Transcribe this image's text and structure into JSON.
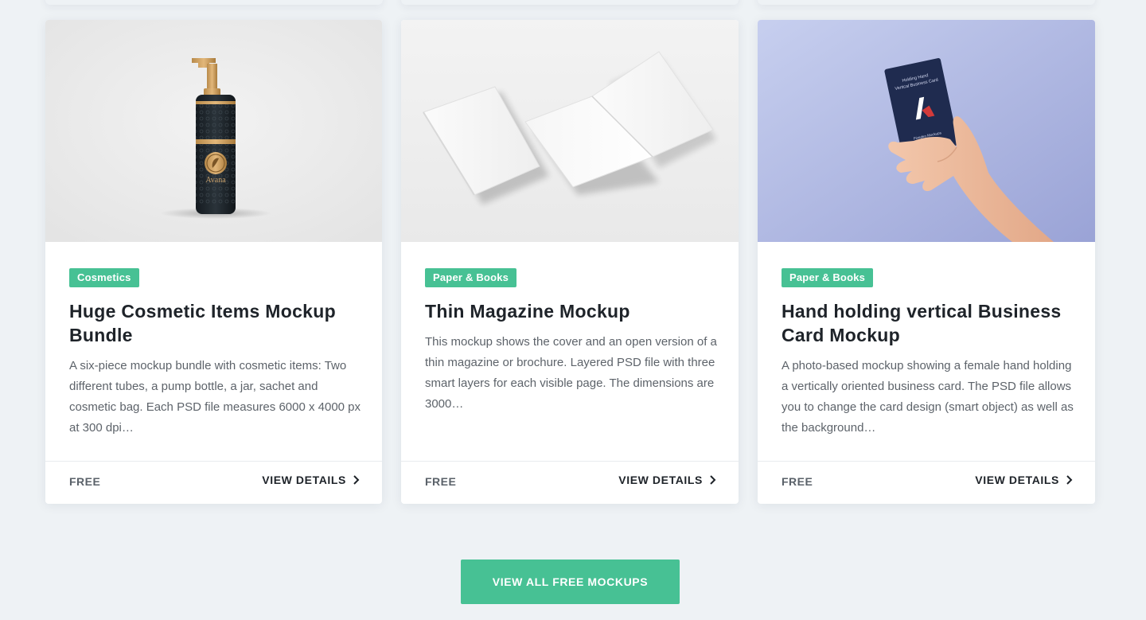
{
  "colors": {
    "accent": "#47c194",
    "page_bg": "#eef2f5",
    "title": "#1e2329",
    "body_text": "#5d636a"
  },
  "cards": [
    {
      "image_icon": "pump-bottle-image",
      "category": "Cosmetics",
      "title": "Huge Cosmetic Items Mockup Bundle",
      "description": "A six-piece mockup bundle with cosmetic items: Two different tubes, a pump bottle, a jar, sachet and cosmetic bag. Each PSD file measures 6000 x 4000 px at 300 dpi…",
      "price": "FREE",
      "details_label": "VIEW DETAILS",
      "image_text": "Avana"
    },
    {
      "image_icon": "magazine-image",
      "category": "Paper & Books",
      "title": "Thin Magazine Mockup",
      "description": "This mockup shows the cover and an open version of a thin magazine or brochure. Layered PSD file with three smart layers for each visible page. The dimensions are 3000…",
      "price": "FREE",
      "details_label": "VIEW DETAILS"
    },
    {
      "image_icon": "hand-business-card-image",
      "category": "Paper & Books",
      "title": "Hand holding vertical Business Card Mockup",
      "description": "A photo-based mockup showing a female hand holding a vertically oriented business card. The PSD file allows you to change the card design (smart object) as well as the background…",
      "price": "FREE",
      "details_label": "VIEW DETAILS",
      "image_text": "Holding Hand Vertical Business Card"
    }
  ],
  "cta_label": "VIEW ALL FREE MOCKUPS"
}
